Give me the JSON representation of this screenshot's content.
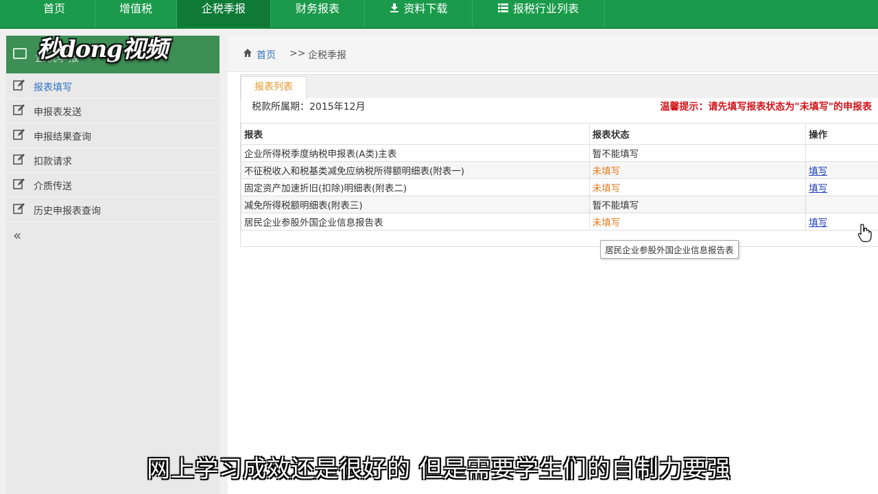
{
  "topnav": {
    "items": [
      {
        "label": "首页"
      },
      {
        "label": "增值税"
      },
      {
        "label": "企税季报"
      },
      {
        "label": "财务报表"
      },
      {
        "label": "资料下载",
        "icon": "download-icon"
      },
      {
        "label": "报税行业列表",
        "icon": "list-icon"
      }
    ],
    "active": "企税季报",
    "color": "#1a9a4a"
  },
  "watermark": {
    "text": "秒dong视频"
  },
  "sidebar": {
    "header_title": "企税季报",
    "items": [
      {
        "label": "报表填写"
      },
      {
        "label": "申报表发送"
      },
      {
        "label": "申报结果查询"
      },
      {
        "label": "扣款请求"
      },
      {
        "label": "介质传送"
      },
      {
        "label": "历史申报表查询"
      }
    ],
    "collapse_label": "«"
  },
  "breadcrumb": {
    "home": "首页",
    "separator": ">>",
    "current": "企税季报"
  },
  "panel": {
    "tab_label": "报表列表",
    "period": "税款所属期：2015年12月",
    "warning": "温馨提示：请先填写报表状态为\"未填写\"的申报表"
  },
  "table": {
    "headers": [
      "报表",
      "报表状态",
      "操作"
    ],
    "rows": [
      {
        "name": "企业所得税季度纳税申报表(A类)主表",
        "status": "暂不能填写",
        "action": ""
      },
      {
        "name": "不征税收入和税基类减免应纳税所得额明细表(附表一)",
        "status": "未填写",
        "action": "填写"
      },
      {
        "name": "固定资产加速折旧(扣除)明细表(附表二)",
        "status": "未填写",
        "action": "填写"
      },
      {
        "name": "减免所得税额明细表(附表三)",
        "status": "暂不能填写",
        "action": ""
      },
      {
        "name": "居民企业参股外国企业信息报告表",
        "status": "未填写",
        "action": "填写"
      }
    ]
  },
  "tooltip": "居民企业参股外国企业信息报告表",
  "subtitle": "网上学习成效还是很好的 但是需要学生们的自制力要强",
  "colors": {
    "status_pending": "#e07b1f",
    "warning": "#d0141a",
    "link": "#1a3bb8"
  }
}
